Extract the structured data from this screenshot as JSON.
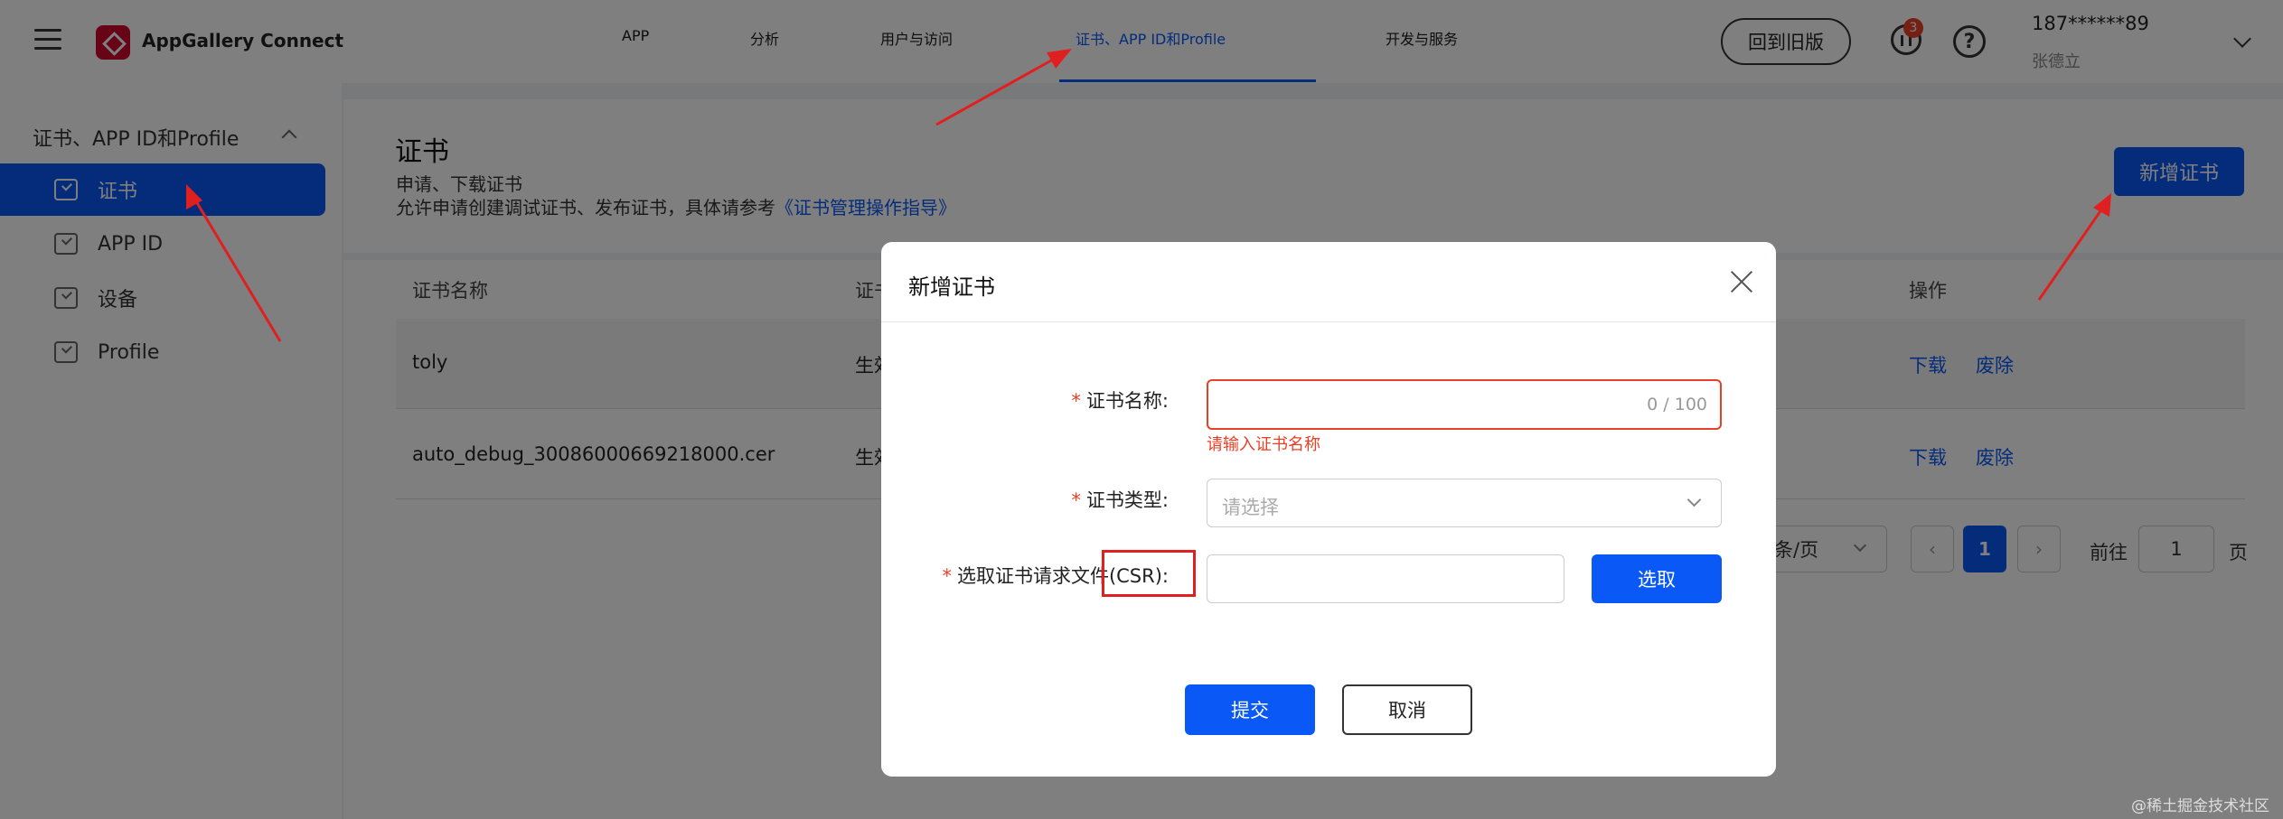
{
  "header": {
    "brand": "AppGallery Connect",
    "nav": [
      "APP",
      "分析",
      "用户与访问",
      "证书、APP ID和Profile",
      "开发与服务"
    ],
    "old_version_button": "回到旧版",
    "message_badge": "3",
    "help_glyph": "?",
    "user_phone": "187******89",
    "user_name": "张德立"
  },
  "sidebar": {
    "group_title": "证书、APP ID和Profile",
    "items": [
      "证书",
      "APP ID",
      "设备",
      "Profile"
    ]
  },
  "page": {
    "title": "证书",
    "subtitle": "申请、下载证书",
    "description_prefix": "允许申请创建调试证书、发布证书，具体请参考",
    "description_link": "《证书管理操作指导》",
    "add_button": "新增证书"
  },
  "table": {
    "col_name": "证书名称",
    "col_second": "证书",
    "col_action": "操作",
    "rows": [
      {
        "name": "toly",
        "second": "生效"
      },
      {
        "name": "auto_debug_30086000669218000.cer",
        "second": "生效"
      }
    ],
    "action_download": "下载",
    "action_revoke": "废除"
  },
  "pagination": {
    "page_size_text": "条/页",
    "current_page": "1",
    "prev_glyph": "‹",
    "next_glyph": "›",
    "goto_label": "前往",
    "goto_value": "1",
    "goto_unit": "页"
  },
  "dialog": {
    "title": "新增证书",
    "required_mark": "*",
    "name_label": "证书名称:",
    "name_count": "0 / 100",
    "name_error": "请输入证书名称",
    "type_label": "证书类型:",
    "type_placeholder": "请选择",
    "csr_label": "选取证书请求文件(CSR):",
    "pick_button": "选取",
    "submit_button": "提交",
    "cancel_button": "取消"
  },
  "watermark": "@稀土掘金技术社区",
  "colors": {
    "accent": "#0a59f7",
    "error": "#e84026",
    "annotation": "#e02020"
  }
}
